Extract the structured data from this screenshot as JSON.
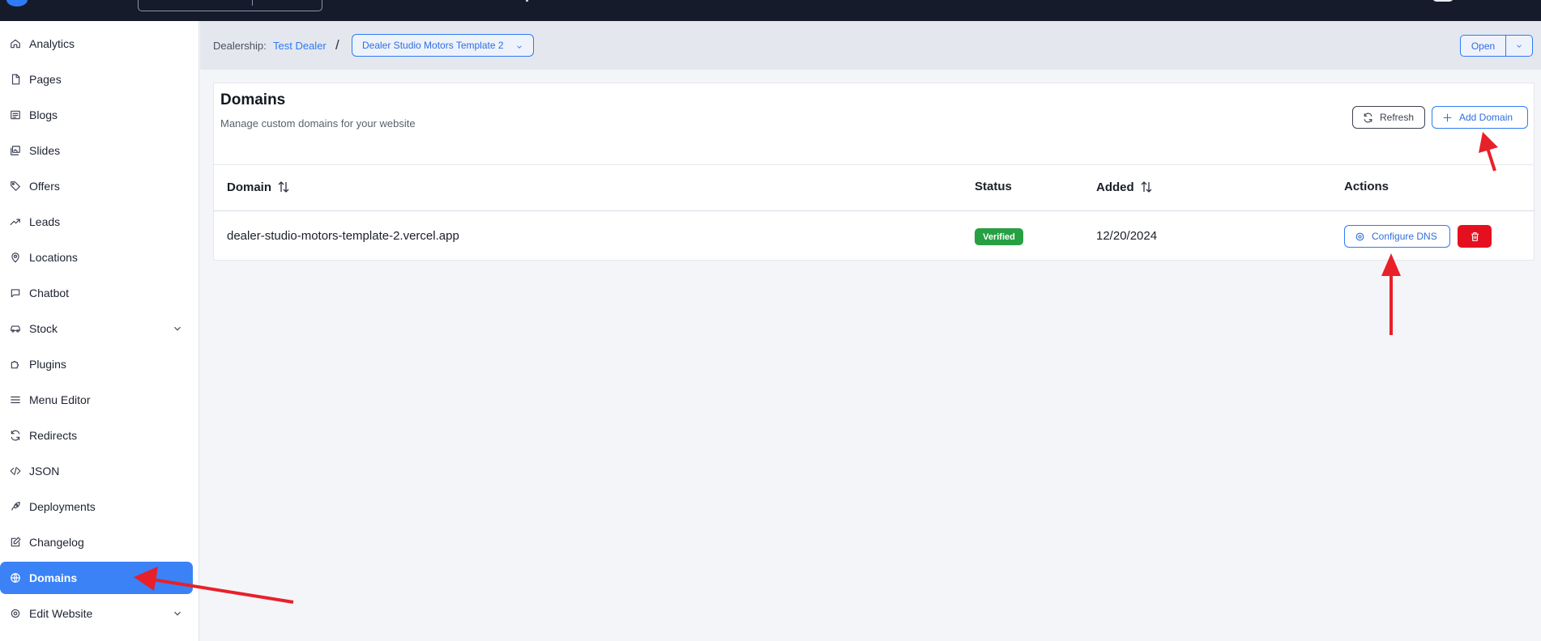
{
  "sidebar": {
    "items": [
      {
        "label": "Analytics",
        "icon": "home-icon"
      },
      {
        "label": "Pages",
        "icon": "file-icon"
      },
      {
        "label": "Blogs",
        "icon": "newspaper-icon"
      },
      {
        "label": "Slides",
        "icon": "images-icon"
      },
      {
        "label": "Offers",
        "icon": "tag-icon"
      },
      {
        "label": "Leads",
        "icon": "trending-up-icon"
      },
      {
        "label": "Locations",
        "icon": "map-pin-icon"
      },
      {
        "label": "Chatbot",
        "icon": "chat-bubble-icon"
      },
      {
        "label": "Stock",
        "icon": "car-icon"
      },
      {
        "label": "Plugins",
        "icon": "puzzle-icon"
      },
      {
        "label": "Menu Editor",
        "icon": "menu-lines-icon"
      },
      {
        "label": "Redirects",
        "icon": "refresh-arrows-icon"
      },
      {
        "label": "JSON",
        "icon": "code-icon"
      },
      {
        "label": "Deployments",
        "icon": "rocket-icon"
      },
      {
        "label": "Changelog",
        "icon": "edit-square-icon"
      },
      {
        "label": "Domains",
        "icon": "globe-icon"
      },
      {
        "label": "Edit Website",
        "icon": "settings-icon"
      }
    ],
    "active": "Domains"
  },
  "header": {
    "dealership_label": "Dealership:",
    "dealership_name": "Test Dealer",
    "separator": "/",
    "site_select": "Dealer Studio Motors Template 2",
    "open_label": "Open"
  },
  "card": {
    "title": "Domains",
    "subtitle": "Manage custom domains for your website",
    "refresh_label": "Refresh",
    "add_label": "Add Domain"
  },
  "table": {
    "headers": {
      "domain": "Domain",
      "status": "Status",
      "added": "Added",
      "actions": "Actions"
    },
    "rows": [
      {
        "domain": "dealer-studio-motors-template-2.vercel.app",
        "status": "Verified",
        "added": "12/20/2024",
        "action_label": "Configure DNS"
      }
    ]
  },
  "colors": {
    "accent": "#3b82f6",
    "status_verified": "#26a043",
    "delete": "#e5101f",
    "annotation_arrow": "#e8202a"
  }
}
